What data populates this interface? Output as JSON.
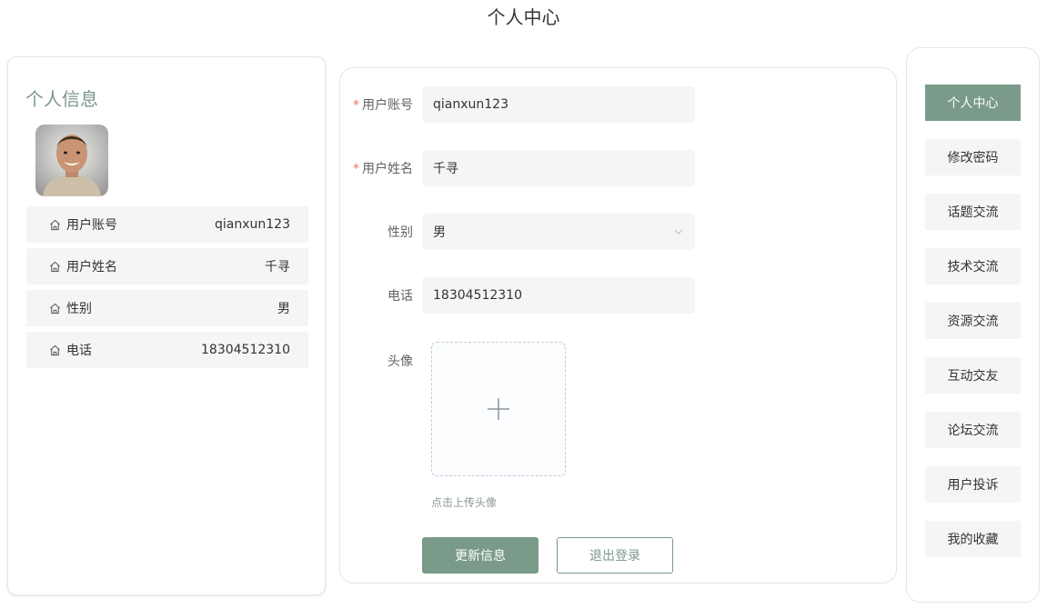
{
  "page": {
    "title": "个人中心"
  },
  "profile_card": {
    "title": "个人信息",
    "rows": [
      {
        "label": "用户账号",
        "value": "qianxun123"
      },
      {
        "label": "用户姓名",
        "value": "千寻"
      },
      {
        "label": "性别",
        "value": "男"
      },
      {
        "label": "电话",
        "value": "18304512310"
      }
    ]
  },
  "form": {
    "account": {
      "label": "用户账号",
      "required_mark": "*",
      "value": "qianxun123"
    },
    "name": {
      "label": "用户姓名",
      "required_mark": "*",
      "value": "千寻"
    },
    "gender": {
      "label": "性别",
      "value": "男"
    },
    "phone": {
      "label": "电话",
      "value": "18304512310"
    },
    "avatar": {
      "label": "头像",
      "hint": "点击上传头像"
    },
    "update_button": "更新信息",
    "logout_button": "退出登录"
  },
  "menu": {
    "items": [
      {
        "label": "个人中心",
        "active": true
      },
      {
        "label": "修改密码"
      },
      {
        "label": "话题交流"
      },
      {
        "label": "技术交流"
      },
      {
        "label": "资源交流"
      },
      {
        "label": "互动交友"
      },
      {
        "label": "论坛交流"
      },
      {
        "label": "用户投诉"
      },
      {
        "label": "我的收藏"
      }
    ]
  },
  "colors": {
    "accent": "#7a9a8a",
    "required": "#f56c6c",
    "field_bg": "#f5f5f5"
  }
}
